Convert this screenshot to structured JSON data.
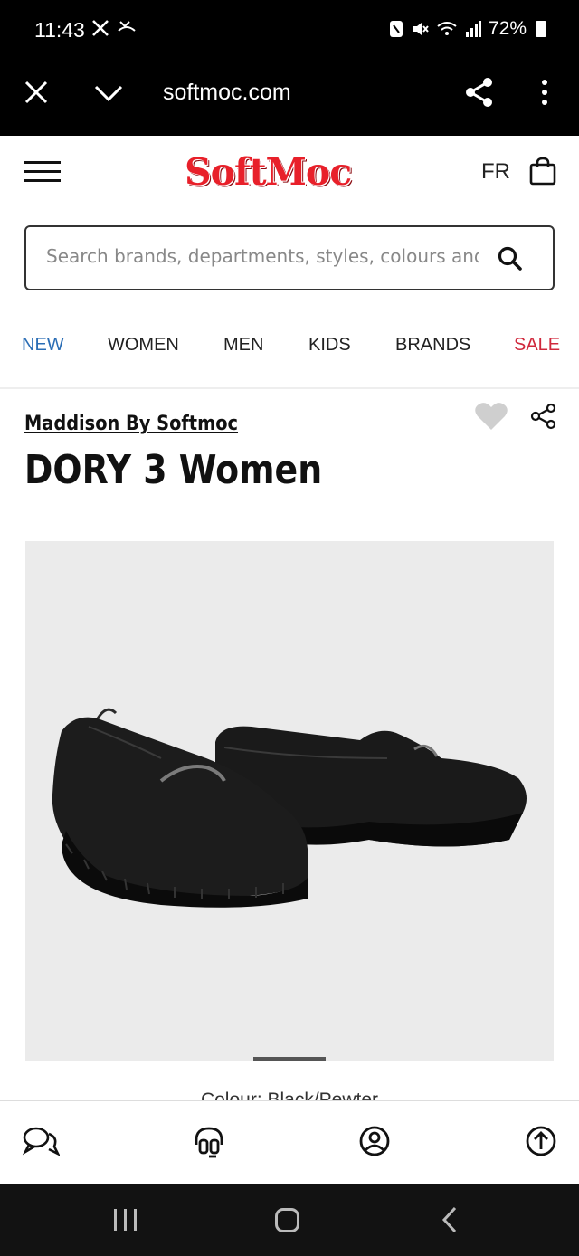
{
  "status_bar": {
    "time": "11:43",
    "battery": "72%",
    "left_icons": [
      "x-icon",
      "missed-call-icon"
    ],
    "right_icons": [
      "nfc-icon",
      "mute-icon",
      "wifi-icon",
      "signal-icon",
      "battery-icon"
    ]
  },
  "browser": {
    "url": "softmoc.com"
  },
  "header": {
    "logo": "SoftMoc",
    "language": "FR"
  },
  "search": {
    "placeholder": "Search brands, departments, styles, colours and r"
  },
  "nav": {
    "items": [
      {
        "label": "NEW",
        "color": "#2a6db5"
      },
      {
        "label": "WOMEN",
        "color": "#222222"
      },
      {
        "label": "MEN",
        "color": "#222222"
      },
      {
        "label": "KIDS",
        "color": "#222222"
      },
      {
        "label": "BRANDS",
        "color": "#222222"
      },
      {
        "label": "SALE",
        "color": "#d0283c"
      }
    ]
  },
  "product": {
    "brand": "Maddison By Softmoc",
    "title": "DORY 3 Women",
    "colour_label": "Colour: Black/Pewter"
  },
  "colors": {
    "brand_red": "#e8202a",
    "nav_new": "#2a6db5",
    "nav_sale": "#d0283c"
  }
}
